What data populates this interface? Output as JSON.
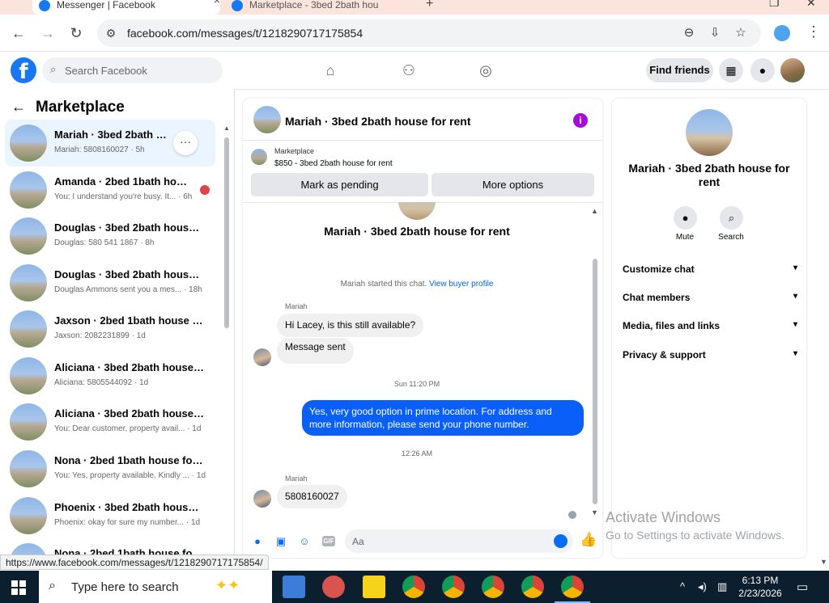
{
  "browser": {
    "tabs": [
      {
        "title": "Messenger | Facebook",
        "active": true
      },
      {
        "title": "Marketplace - 3bed 2bath hou",
        "active": false
      }
    ],
    "url": "facebook.com/messages/t/1218290717175854",
    "status_url": "https://www.facebook.com/messages/t/1218290717175854/"
  },
  "fb": {
    "search_placeholder": "Search Facebook",
    "find_friends": "Find friends"
  },
  "chat_list": {
    "title": "Marketplace",
    "items": [
      {
        "name": "Mariah · 3bed 2bath house for rent",
        "preview": "Mariah: 5808160027 · 5h",
        "active": true
      },
      {
        "name": "Amanda · 2bed 1bath house for rent",
        "preview": "You: I understand you're busy. It... · 6h",
        "active": false
      },
      {
        "name": "Douglas · 3bed 2bath house for rent",
        "preview": "Douglas: 580 541 1867 · 8h",
        "active": false
      },
      {
        "name": "Douglas · 3bed 2bath house for rent",
        "preview": "Douglas Ammons sent you a mes... · 18h",
        "active": false
      },
      {
        "name": "Jaxson · 2bed 1bath house for rent",
        "preview": "Jaxson: 2082231899 · 1d",
        "active": false
      },
      {
        "name": "Aliciana · 3bed 2bath house for rent",
        "preview": "Aliciana: 5805544092 · 1d",
        "active": false
      },
      {
        "name": "Aliciana · 3bed 2bath house for rent",
        "preview": "You: Dear customer, property avail... · 1d",
        "active": false
      },
      {
        "name": "Nona · 2bed 1bath house for rent",
        "preview": "You: Yes, property available. Kindly ... · 1d",
        "active": false
      },
      {
        "name": "Phoenix · 3bed 2bath house for rent",
        "preview": "Phoenix: okay for sure my number... · 1d",
        "active": false
      },
      {
        "name": "Nona · 2bed 1bath house for rent",
        "preview": "",
        "active": false
      }
    ]
  },
  "conversation": {
    "title": "Mariah · 3bed 2bath house for rent",
    "marketplace_label": "Marketplace",
    "listing": "$850 - 3bed 2bath house for rent",
    "mark_pending": "Mark as pending",
    "more_options": "More options",
    "intro_title": "Mariah · 3bed 2bath house for rent",
    "started_text": "Mariah started this chat.",
    "view_profile": "View buyer profile",
    "sender_name": "Mariah",
    "msg1": "Hi Lacey, is this still available?",
    "msg2": "Message sent",
    "time1": "Sun 11:20 PM",
    "msg3": "Yes, very good option in prime location. For address and more information, please send your phone number.",
    "time2": "12:26 AM",
    "sender_name2": "Mariah",
    "msg4": "5808160027",
    "composer_placeholder": "Aa"
  },
  "info_panel": {
    "title": "Mariah · 3bed 2bath house for rent",
    "mute": "Mute",
    "search": "Search",
    "sections": [
      "Customize chat",
      "Chat members",
      "Media, files and links",
      "Privacy & support"
    ]
  },
  "windows": {
    "activate_title": "Activate Windows",
    "activate_sub": "Go to Settings to activate Windows.",
    "search_placeholder": "Type here to search",
    "time": "6:13 PM",
    "date": "2/23/2026"
  }
}
